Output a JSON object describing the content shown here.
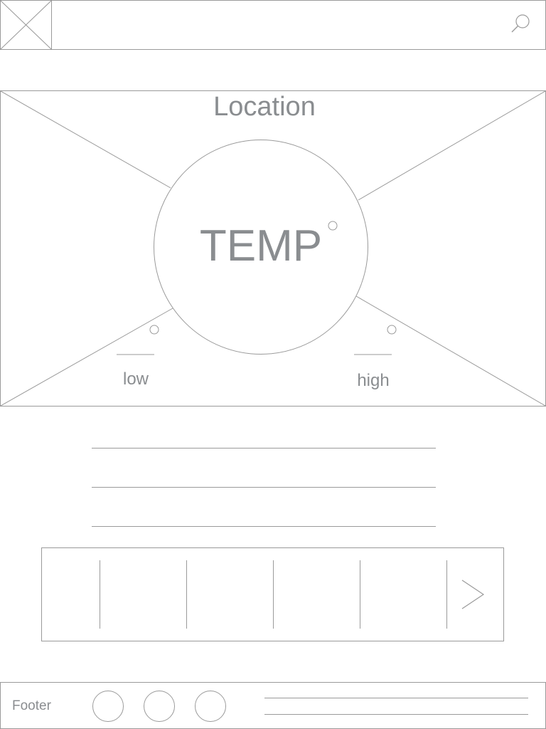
{
  "hero": {
    "location": "Location",
    "temp": "TEMP",
    "low_label": "low",
    "high_label": "high"
  },
  "forecast_strip": {
    "slot_count": 5,
    "next_icon": "chevron-right-icon"
  },
  "footer": {
    "label": "Footer",
    "social_icon_count": 3
  },
  "colors": {
    "stroke": "#9a9a9a",
    "text": "#8a8d90",
    "background": "#ffffff"
  }
}
